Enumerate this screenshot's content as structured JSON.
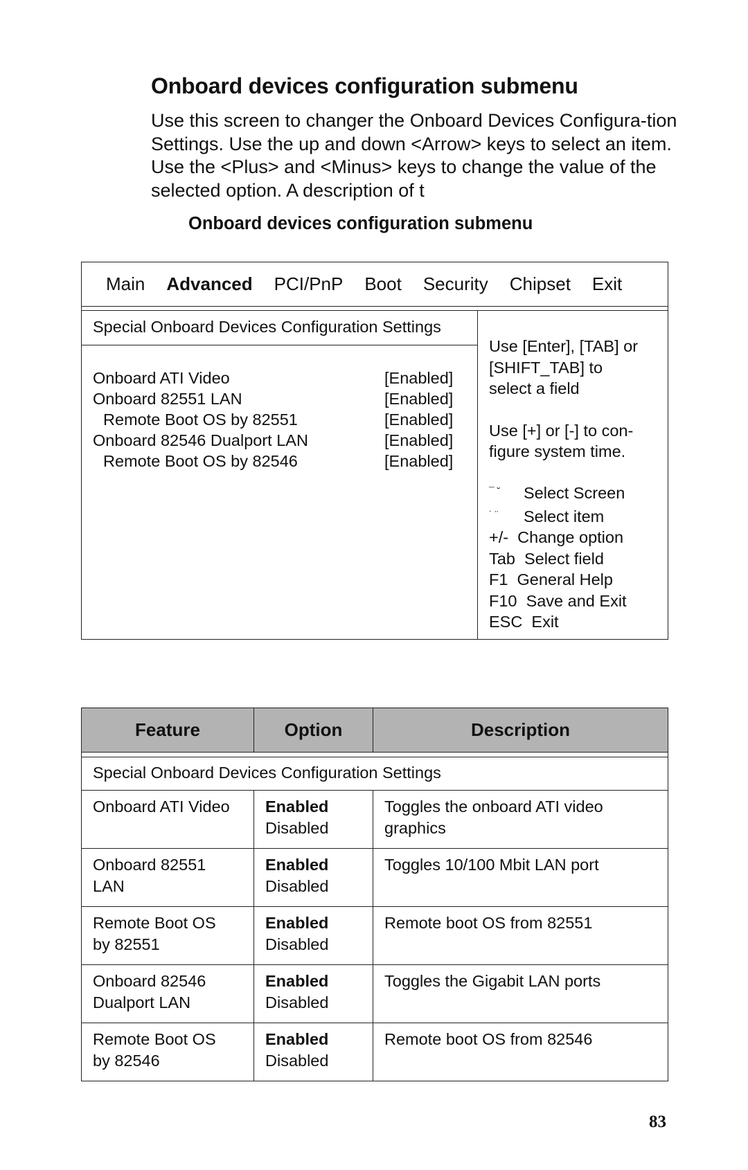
{
  "heading": "Onboard devices configuration submenu",
  "intro": "Use this screen to changer the Onboard Devices Configura-tion Settings. Use the up and down <Arrow> keys to select an item. Use the <Plus> and <Minus> keys to change the value of the selected option. A description of t",
  "figure_caption": "Onboard devices configuration submenu",
  "bios": {
    "menu": [
      {
        "label": "Main",
        "active": false
      },
      {
        "label": "Advanced",
        "active": true
      },
      {
        "label": "PCI/PnP",
        "active": false
      },
      {
        "label": "Boot",
        "active": false
      },
      {
        "label": "Security",
        "active": false
      },
      {
        "label": "Chipset",
        "active": false
      },
      {
        "label": "Exit",
        "active": false
      }
    ],
    "section_title": "Special Onboard Devices Configuration Settings",
    "settings": [
      {
        "label": "Onboard ATI Video",
        "value": "[Enabled]",
        "indent": false
      },
      {
        "label": "Onboard 82551 LAN",
        "value": "[Enabled]",
        "indent": false
      },
      {
        "label": "Remote Boot OS by 82551",
        "value": "[Enabled]",
        "indent": true
      },
      {
        "label": "Onboard 82546 Dualport LAN",
        "value": "[Enabled]",
        "indent": false
      },
      {
        "label": "Remote Boot OS by 82546",
        "value": "[Enabled]",
        "indent": true
      }
    ],
    "help_lines_1": [
      "Use [Enter], [TAB] or",
      "[SHIFT_TAB] to",
      "select a field"
    ],
    "help_lines_2": [
      "Use [+] or [-] to con-",
      "figure system time."
    ],
    "keys": [
      {
        "key": "¯ ˘",
        "action": "Select Screen",
        "glyph": true
      },
      {
        "key": "˙ ¨",
        "action": "Select item",
        "glyph": true
      },
      {
        "key": "+/-",
        "action": "Change option",
        "glyph": false
      },
      {
        "key": "Tab",
        "action": "Select field",
        "glyph": false
      },
      {
        "key": "F1",
        "action": "General Help",
        "glyph": false
      },
      {
        "key": "F10",
        "action": "Save and Exit",
        "glyph": false
      },
      {
        "key": "ESC",
        "action": "Exit",
        "glyph": false
      }
    ]
  },
  "table": {
    "headers": [
      "Feature",
      "Option",
      "Description"
    ],
    "section_title": "Special Onboard Devices Configuration Settings",
    "rows": [
      {
        "feature": [
          "Onboard ATI Video"
        ],
        "options": [
          "Enabled",
          "Disabled"
        ],
        "default": "Enabled",
        "description": "Toggles the onboard ATI video graphics"
      },
      {
        "feature": [
          "Onboard 82551",
          "LAN"
        ],
        "options": [
          "Enabled",
          "Disabled"
        ],
        "default": "Enabled",
        "description": "Toggles 10/100 Mbit LAN port"
      },
      {
        "feature": [
          "Remote Boot OS",
          "by 82551"
        ],
        "options": [
          "Enabled",
          "Disabled"
        ],
        "default": "Enabled",
        "description": "Remote boot OS from 82551"
      },
      {
        "feature": [
          "Onboard 82546",
          "Dualport LAN"
        ],
        "options": [
          "Enabled",
          "Disabled"
        ],
        "default": "Enabled",
        "description": "Toggles the Gigabit LAN ports"
      },
      {
        "feature": [
          "Remote Boot OS",
          "by 82546"
        ],
        "options": [
          "Enabled",
          "Disabled"
        ],
        "default": "Enabled",
        "description": "Remote boot OS from 82546"
      }
    ]
  },
  "page_number": "83",
  "colors": {
    "table_header_bg": "#b3b3b3",
    "text": "#111111",
    "border": "#222222"
  }
}
